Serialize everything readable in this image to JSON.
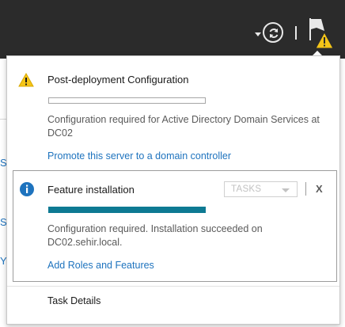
{
  "topbar": {
    "dropdown_icon": "triangle-down",
    "refresh_icon": "refresh-circle",
    "notifications_icon": "flag-with-warning"
  },
  "background": {
    "edge_letters": [
      "S",
      "S",
      "Y"
    ]
  },
  "notifications": [
    {
      "icon": "warning-triangle",
      "title": "Post-deployment Configuration",
      "progress": 0,
      "message": "Configuration required for Active Directory Domain Services at DC02",
      "link": "Promote this server to a domain controller"
    },
    {
      "icon": "info-circle",
      "title": "Feature installation",
      "tasks_label": "TASKS",
      "close_label": "X",
      "progress": 1,
      "message": "Configuration required. Installation succeeded on DC02.sehir.local.",
      "link": "Add Roles and Features"
    }
  ],
  "footer": {
    "task_details": "Task Details"
  },
  "colors": {
    "topbar": "#2b2b2b",
    "accent": "#0e7a93",
    "link": "#1e73be",
    "warning": "#f5c518",
    "info": "#1e73be"
  }
}
